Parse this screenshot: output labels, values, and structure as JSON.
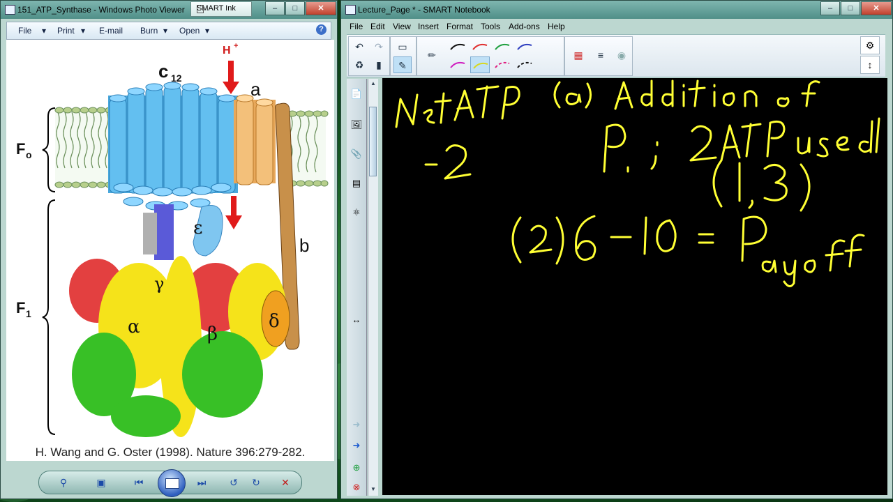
{
  "photo_viewer": {
    "title": "151_ATP_Synthase - Windows Photo Viewer",
    "ink_toolbar": "SMART Ink",
    "menu": [
      "File",
      "Print",
      "E-mail",
      "Burn",
      "Open"
    ],
    "help": "?",
    "figure_labels": {
      "c12": "c",
      "c12_sub": "12",
      "h_plus": "H",
      "h_plus_sup": "+",
      "a": "a",
      "b": "b",
      "epsilon": "ε",
      "gamma": "γ",
      "alpha": "α",
      "beta": "β",
      "delta": "δ",
      "fo": "F",
      "fo_sub": "o",
      "f1": "F",
      "f1_sub": "1"
    },
    "caption": "H. Wang and G. Oster (1998). Nature 396:279-282."
  },
  "notebook": {
    "title": "Lecture_Page * - SMART Notebook",
    "menu": [
      "File",
      "Edit",
      "View",
      "Insert",
      "Format",
      "Tools",
      "Add-ons",
      "Help"
    ],
    "handwriting": {
      "line1_left": "Net ATP",
      "line1_right": "(a) Addition of",
      "line2_left": "-2",
      "line2_right": "Pi ; 2 ATP used",
      "line3_right": "(1,3)",
      "line4": "(2) 6-10 = Payoff"
    },
    "colors": {
      "ink": "#ffff33",
      "board": "#000000"
    }
  }
}
